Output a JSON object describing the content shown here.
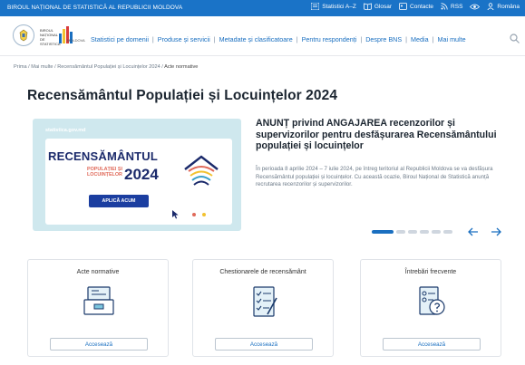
{
  "topbar": {
    "org": "BIROUL NAȚIONAL DE STATISTICĂ AL REPUBLICII MOLDOVA",
    "links": [
      {
        "label": "Statistici A–Z",
        "icon": "list-icon"
      },
      {
        "label": "Glosar",
        "icon": "book-icon"
      },
      {
        "label": "Contacte",
        "icon": "contact-card-icon"
      },
      {
        "label": "RSS",
        "icon": "rss-icon"
      },
      {
        "label": "",
        "icon": "eye-icon"
      },
      {
        "label": "Româna",
        "icon": "user-icon"
      }
    ]
  },
  "header": {
    "logo_text": "BIROUL NAȚIONAL DE STATISTICĂ",
    "logo_rs": "MOLDOVA",
    "nav": [
      "Statistici pe domenii",
      "Produse și servicii",
      "Metadate și clasificatoare",
      "Pentru respondenți",
      "Despre BNS",
      "Media",
      "Mai multe"
    ]
  },
  "breadcrumb": {
    "items": [
      "Prima",
      "Mai multe",
      "Recensământul Populației și Locuințelor 2024"
    ],
    "current": "Acte normative"
  },
  "page": {
    "title": "Recensământul Populației și Locuințelor 2024"
  },
  "banner": {
    "site": "statistica.gov.md",
    "title": "RECENSĂMÂNTUL",
    "sub1": "POPULAȚIEI ȘI",
    "sub2": "LOCUINȚELOR",
    "year": "2024",
    "cta": "APLICĂ ACUM"
  },
  "news": {
    "title": "ANUNȚ privind ANGAJAREA recenzorilor și supervizorilor pentru desfășurarea Recensământului populației și locuințelor",
    "body": "În perioada 8 aprilie 2024 – 7 iulie 2024, pe întreg teritoriul al Republicii Moldova se va desfășura Recensământul populației și locuințelor. Cu această ocazie, Biroul Național de Statistică anunță recrutarea recenzorilor și supervizorilor."
  },
  "carousel": {
    "slides": 6,
    "active": 1
  },
  "cards": [
    {
      "title": "Acte normative",
      "icon": "documents-icon",
      "button": "Accesează"
    },
    {
      "title": "Chestionarele de recensământ",
      "icon": "checklist-icon",
      "button": "Accesează"
    },
    {
      "title": "Întrebări frecvente",
      "icon": "faq-icon",
      "button": "Accesează"
    }
  ],
  "colors": {
    "primary": "#1a73c7",
    "link": "#1a6fc0",
    "banner_navy": "#1b2a6b",
    "accent": "#e06a5a"
  }
}
